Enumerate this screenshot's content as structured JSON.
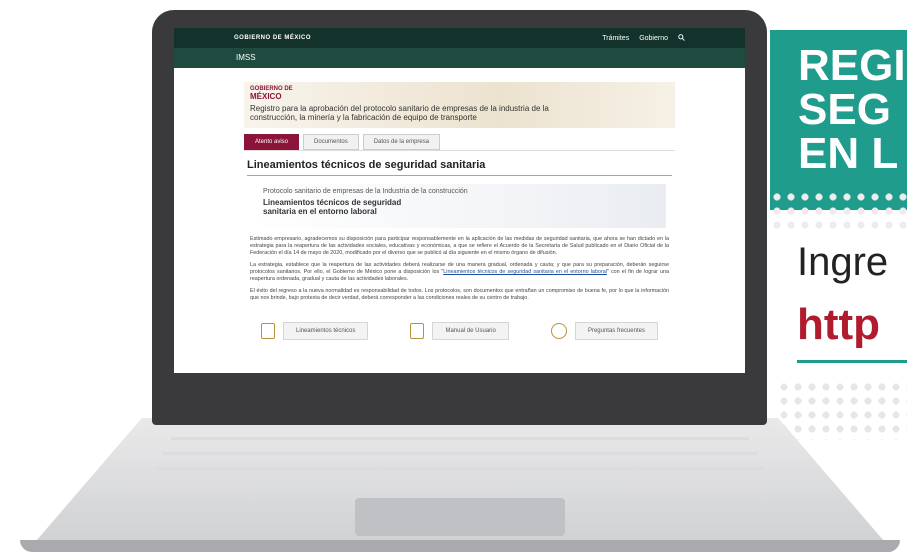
{
  "banner": {
    "line1": "REGI",
    "line2": "SEG",
    "line3": "EN L"
  },
  "promo": {
    "ingresa": "Ingre",
    "url": "http"
  },
  "colors": {
    "gov_green": "#13322b",
    "accent": "#8a1538",
    "banner_teal": "#1f9c8c",
    "url_red": "#b01c2e"
  },
  "gov_header": {
    "logo": "GOBIERNO DE MÉXICO",
    "nav": [
      "Trámites",
      "Gobierno"
    ],
    "search_icon": "search-icon"
  },
  "imss_bar": {
    "label": "IMSS"
  },
  "hero": {
    "logo_small": "GOBIERNO DE",
    "logo_big": "MÉXICO",
    "title": "Registro para la aprobación del protocolo sanitario de empresas de la industria de la construcción, la minería y la fabricación de equipo de transporte"
  },
  "tabs": [
    {
      "label": "Atento aviso",
      "active": true
    },
    {
      "label": "Documentos",
      "active": false
    },
    {
      "label": "Datos de la empresa",
      "active": false
    }
  ],
  "main": {
    "heading": "Lineamientos técnicos de seguridad sanitaria",
    "protocol_sub": "Protocolo sanitario de empresas de la Industria de la construcción",
    "protocol_title": "Lineamientos técnicos de seguridad sanitaria en el entorno laboral",
    "para1": "Estimado empresario, agradecemos su disposición para participar responsablemente en la aplicación de las medidas de seguridad sanitaria, que ahora se han dictado en la estrategia para la reapertura de las actividades sociales, educativas y económicas, a que se refiere el Acuerdo de la Secretaría de Salud publicado en el Diario Oficial de la Federación el día 14 de mayo de 2020, modificado por el diverso que se publicó al día siguiente en el mismo órgano de difusión.",
    "para2_pre": "La estrategia, establece que la reapertura de las actividades deberá realizarse de una manera gradual, ordenada y cauta; y que para su preparación, deberán seguirse protocolos sanitarios. Por ello, el Gobierno de México pone a disposición los \"",
    "para2_link": "Lineamientos técnicos de seguridad sanitaria en el entorno laboral",
    "para2_post": "\" con el fin de lograr una reapertura ordenada, gradual y cauta de las actividades laborales.",
    "para3": "El éxito del regreso a la nueva normalidad es responsabilidad de todos. Los protocolos, son documentos que entrañan un compromiso de buena fe, por lo que la información que nos brinde, bajo protesta de decir verdad, deberá corresponder a las condiciones reales de su centro de trabajo."
  },
  "buttons": [
    {
      "label": "Lineamientos técnicos",
      "icon": "document-icon"
    },
    {
      "label": "Manual de Usuario",
      "icon": "hand-pointer-icon"
    },
    {
      "label": "Preguntas frecuentes",
      "icon": "question-bubble-icon"
    }
  ]
}
